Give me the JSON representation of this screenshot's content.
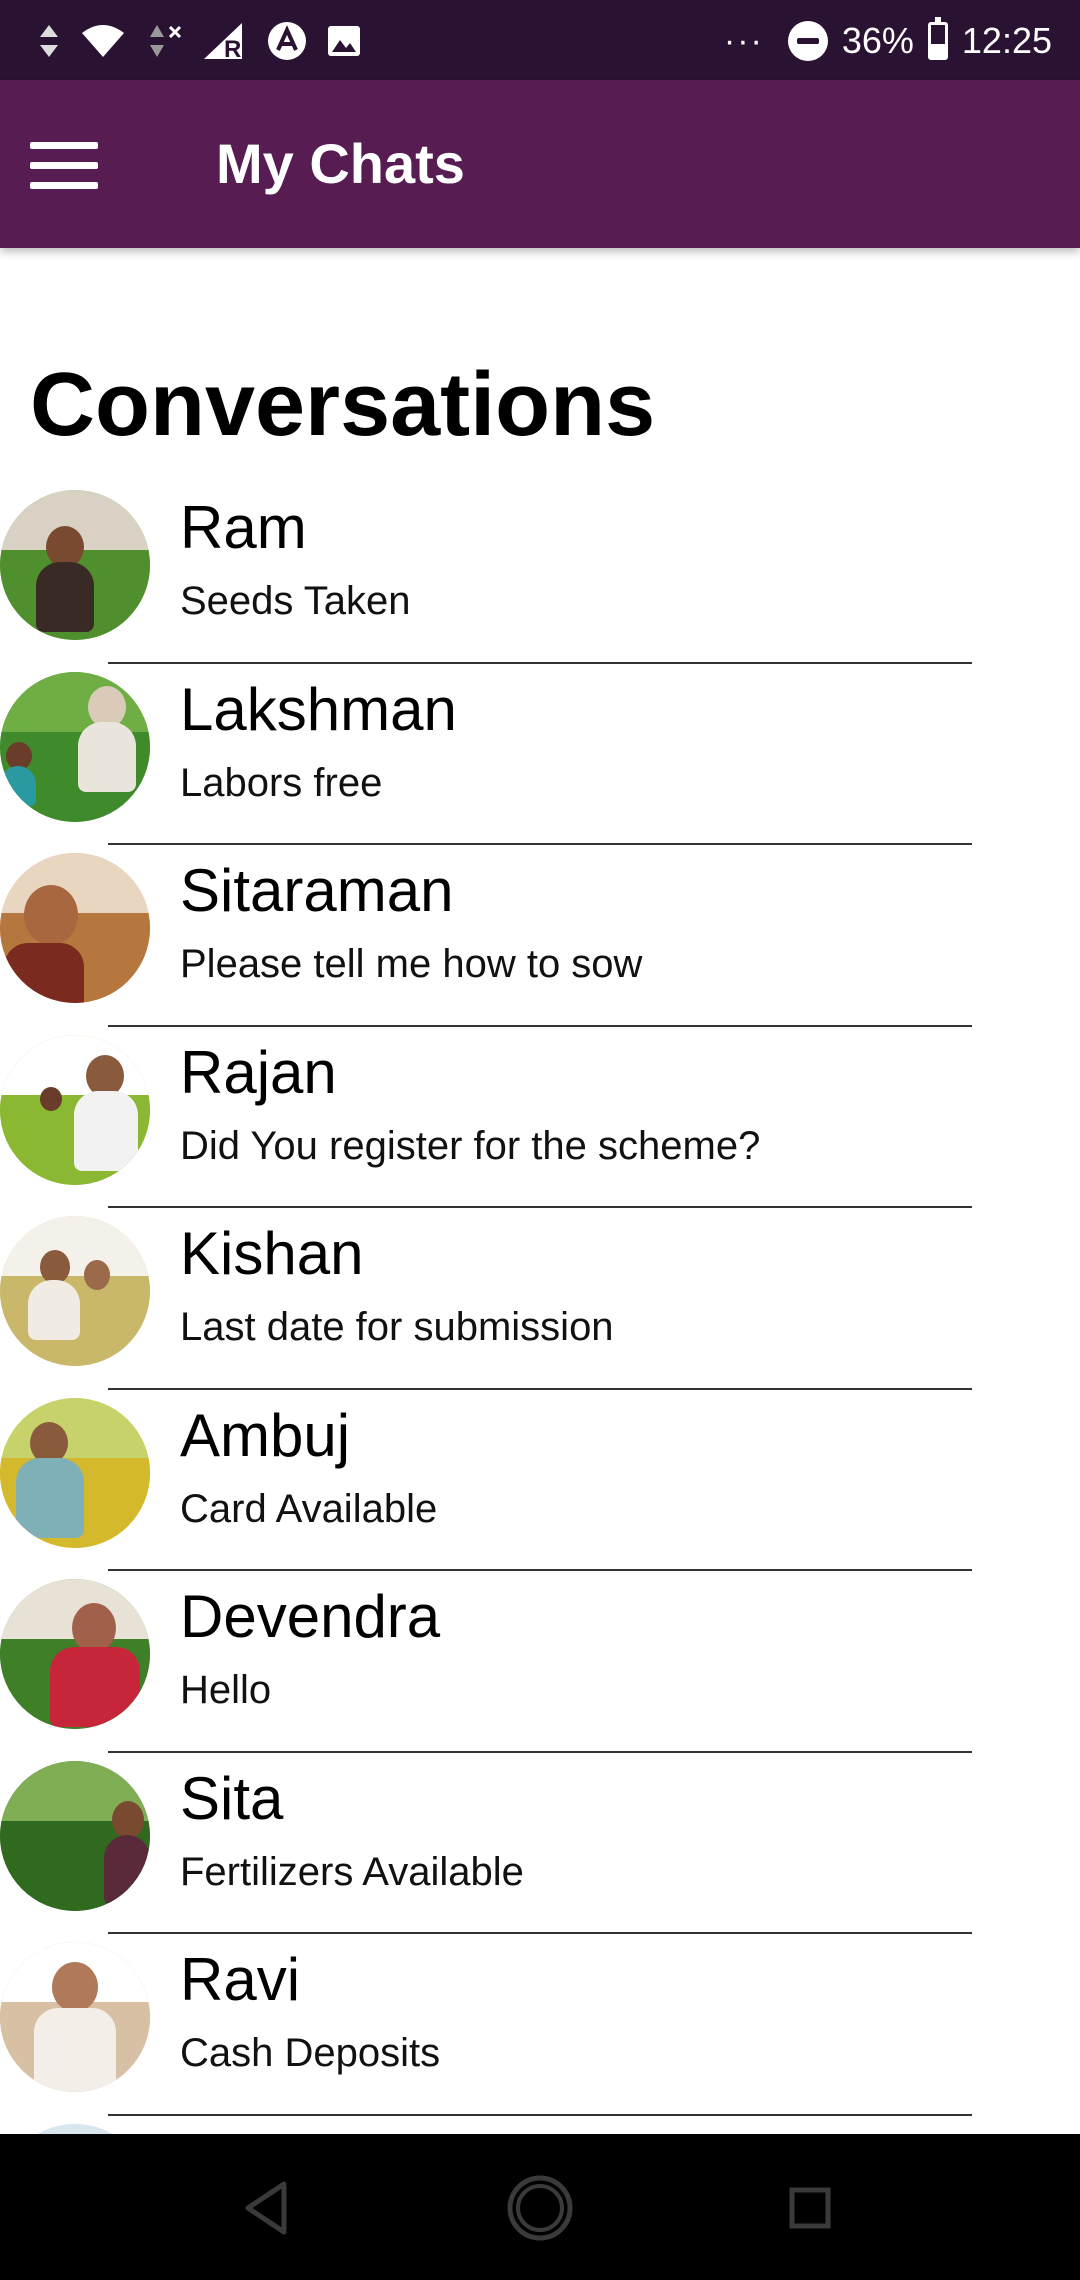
{
  "status_bar": {
    "battery": "36%",
    "time": "12:25",
    "overflow": "···",
    "icons": [
      "data-arrows-icon",
      "wifi-icon",
      "no-signal-icon",
      "roaming-signal-icon",
      "app-a-icon",
      "image-icon",
      "do-not-disturb-icon",
      "battery-icon"
    ]
  },
  "app_bar": {
    "title": "My Chats",
    "menu_icon": "hamburger-menu-icon"
  },
  "section": {
    "heading": "Conversations"
  },
  "chats": [
    {
      "name": "Ram",
      "preview": "Seeds Taken"
    },
    {
      "name": "Lakshman",
      "preview": "Labors free"
    },
    {
      "name": "Sitaraman",
      "preview": "Please tell me how to sow"
    },
    {
      "name": "Rajan",
      "preview": "Did You register for the scheme?"
    },
    {
      "name": "Kishan",
      "preview": "Last date for submission"
    },
    {
      "name": "Ambuj",
      "preview": "Card Available"
    },
    {
      "name": "Devendra",
      "preview": "Hello"
    },
    {
      "name": "Sita",
      "preview": "Fertilizers Available"
    },
    {
      "name": "Ravi",
      "preview": "Cash Deposits"
    }
  ],
  "nav_bar": {
    "icons": [
      "back-icon",
      "home-icon",
      "recents-icon"
    ]
  },
  "colors": {
    "status_bar": "#2a1232",
    "app_bar": "#571c52",
    "background": "#ffffff",
    "nav_bar": "#000000"
  }
}
